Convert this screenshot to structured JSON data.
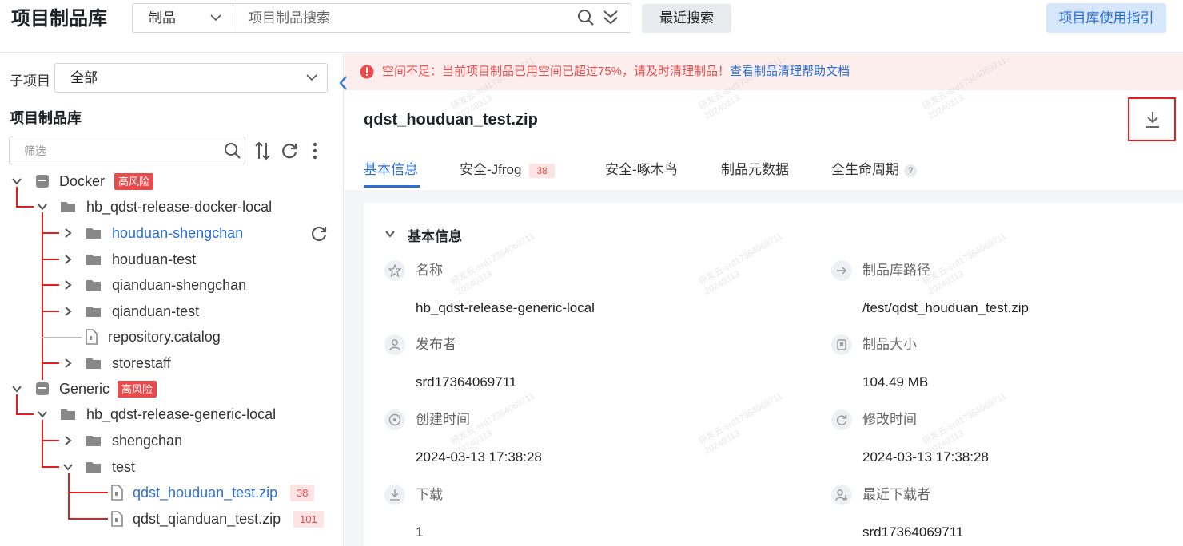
{
  "header": {
    "app_title": "项目制品库",
    "search_type": "制品",
    "search_placeholder": "项目制品搜索",
    "recent_search": "最近搜索",
    "guide": "项目库使用指引"
  },
  "sidebar": {
    "sub_label": "子项目",
    "sub_value": "全部",
    "heading": "项目制品库",
    "filter_placeholder": "筛选",
    "tree": {
      "docker": "Docker",
      "docker_risk": "高风险",
      "docker_repo": "hb_qdst-release-docker-local",
      "houduan_shengchan": "houduan-shengchan",
      "houduan_test": "houduan-test",
      "qianduan_shengchan": "qianduan-shengchan",
      "qianduan_test": "qianduan-test",
      "repository_catalog": "repository.catalog",
      "storestaff": "storestaff",
      "generic": "Generic",
      "generic_risk": "高风险",
      "generic_repo": "hb_qdst-release-generic-local",
      "shengchan": "shengchan",
      "test": "test",
      "file1": "qdst_houduan_test.zip",
      "file1_count": "38",
      "file2": "qdst_qianduan_test.zip",
      "file2_count": "101"
    }
  },
  "main": {
    "alert_text": "空间不足：当前项目制品已用空间已超过75%，请及时清理制品！",
    "alert_link": "查看制品清理帮助文档",
    "file_title": "qdst_houduan_test.zip",
    "tabs": {
      "basic": "基本信息",
      "jfrog": "安全-Jfrog",
      "jfrog_count": "38",
      "woodpecker": "安全-啄木鸟",
      "metadata": "制品元数据",
      "lifecycle": "全生命周期",
      "lifecycle_help": "?"
    },
    "section_title": "基本信息",
    "fields": {
      "name_label": "名称",
      "name_value": "hb_qdst-release-generic-local",
      "path_label": "制品库路径",
      "path_value": "/test/qdst_houduan_test.zip",
      "publisher_label": "发布者",
      "publisher_value": "srd17364069711",
      "size_label": "制品大小",
      "size_value": "104.49 MB",
      "created_label": "创建时间",
      "created_value": "2024-03-13 17:38:28",
      "modified_label": "修改时间",
      "modified_value": "2024-03-13 17:38:28",
      "downloads_label": "下载",
      "downloads_value": "1",
      "last_downloader_label": "最近下载者",
      "last_downloader_value": "srd17364069711"
    },
    "watermark": {
      "line1": "研发云-srd17364069711",
      "line2": "20240313"
    }
  },
  "colors": {
    "accent": "#2b6fd6",
    "danger": "#e84b4b",
    "tree_line": "#e02020"
  }
}
